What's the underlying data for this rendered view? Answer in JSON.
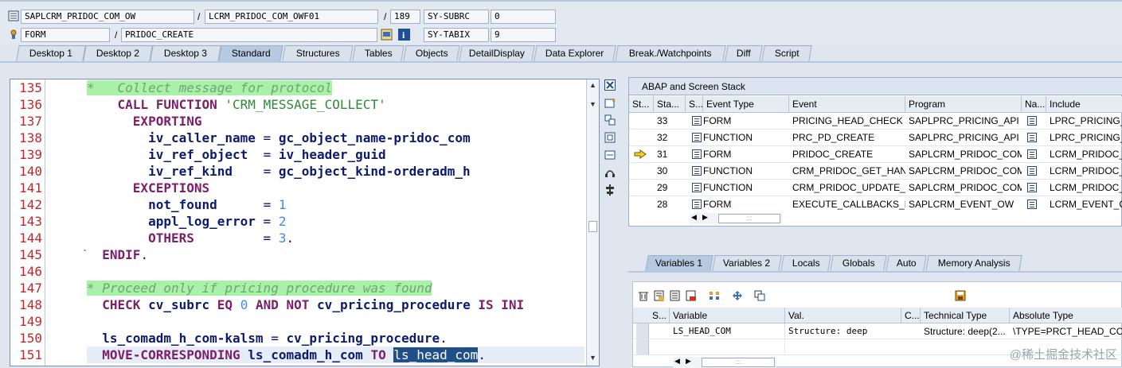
{
  "header": {
    "program": "SAPLCRM_PRIDOC_COM_OW",
    "include": "LCRM_PRIDOC_COM_OWF01",
    "line": "189",
    "sy_subrc_label": "SY-SUBRC",
    "sy_subrc_value": "0",
    "routine_type": "FORM",
    "routine_name": "PRIDOC_CREATE",
    "sy_tabix_label": "SY-TABIX",
    "sy_tabix_value": "9",
    "slash": "/"
  },
  "tabs": [
    "Desktop 1",
    "Desktop 2",
    "Desktop 3",
    "Standard",
    "Structures",
    "Tables",
    "Objects",
    "DetailDisplay",
    "Data Explorer",
    "Break./Watchpoints",
    "Diff",
    "Script"
  ],
  "active_tab": "Standard",
  "code": {
    "line_numbers": [
      "135",
      "136",
      "137",
      "138",
      "139",
      "140",
      "141",
      "142",
      "143",
      "144",
      "145",
      "146",
      "147",
      "148",
      "149",
      "150",
      "151"
    ]
  },
  "stack": {
    "title": "ABAP and Screen Stack",
    "headers": [
      "St...",
      "Sta...",
      "S...",
      "Event Type",
      "Event",
      "Program",
      "Na...",
      "Include"
    ],
    "rows": [
      {
        "level": "33",
        "type": "FORM",
        "event": "PRICING_HEAD_CHECK",
        "program": "SAPLPRC_PRICING_API",
        "include": "LPRC_PRICING_A"
      },
      {
        "level": "32",
        "type": "FUNCTION",
        "event": "PRC_PD_CREATE",
        "program": "SAPLPRC_PRICING_API",
        "include": "LPRC_PRICING_A"
      },
      {
        "level": "31",
        "type": "FORM",
        "event": "PRIDOC_CREATE",
        "program": "SAPLCRM_PRIDOC_COM...",
        "include": "LCRM_PRIDOC_C"
      },
      {
        "level": "30",
        "type": "FUNCTION",
        "event": "CRM_PRIDOC_GET_HAN...",
        "program": "SAPLCRM_PRIDOC_COM...",
        "include": "LCRM_PRIDOC_C"
      },
      {
        "level": "29",
        "type": "FUNCTION",
        "event": "CRM_PRIDOC_UPDATE_...",
        "program": "SAPLCRM_PRIDOC_COM...",
        "include": "LCRM_PRIDOC_C"
      },
      {
        "level": "28",
        "type": "FORM",
        "event": "EXECUTE_CALLBACKS_P...",
        "program": "SAPLCRM_EVENT_OW",
        "include": "LCRM_EVENT_OV"
      }
    ]
  },
  "var_tabs": [
    "Variables 1",
    "Variables 2",
    "Locals",
    "Globals",
    "Auto",
    "Memory Analysis"
  ],
  "variables": {
    "headers": [
      "S...",
      "Variable",
      "Val.",
      "C...",
      "Technical Type",
      "Absolute Type"
    ],
    "rows": [
      {
        "variable": "LS_HEAD_COM",
        "value": "Structure: deep",
        "tech_type": "Structure: deep(2...",
        "abs_type": "\\TYPE=PRCT_HEAD_COM"
      }
    ]
  },
  "watermark": "@稀土掘金技术社区",
  "colors": {
    "accent": "#b7c9e0",
    "line_number": "#c0282a",
    "keyword": "#7b1f6b",
    "comment_bg": "#a9f0a9",
    "selection": "#1f4f86"
  }
}
